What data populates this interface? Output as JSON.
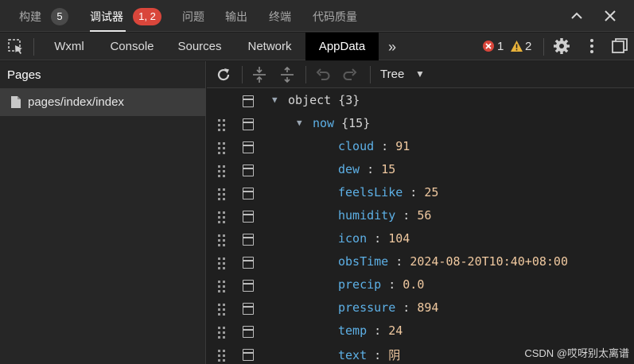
{
  "top_tabs": [
    {
      "label": "构建",
      "badge": "5"
    },
    {
      "label": "调试器",
      "badge": "1, 2"
    },
    {
      "label": "问题"
    },
    {
      "label": "输出"
    },
    {
      "label": "终端"
    },
    {
      "label": "代码质量"
    }
  ],
  "devtools": {
    "tabs": [
      "Wxml",
      "Console",
      "Sources",
      "Network",
      "AppData"
    ],
    "active_tab": "AppData",
    "error_count": "1",
    "warning_count": "2",
    "more_glyph": "»"
  },
  "pages_panel": {
    "title": "Pages",
    "items": [
      "pages/index/index"
    ]
  },
  "appdata_toolbar": {
    "mode_label": "Tree"
  },
  "tree": {
    "root": {
      "key": "object",
      "count": "{3}"
    },
    "now": {
      "key": "now",
      "count": "{15}"
    },
    "fields": [
      {
        "key": "cloud",
        "value": "91"
      },
      {
        "key": "dew",
        "value": "15"
      },
      {
        "key": "feelsLike",
        "value": "25"
      },
      {
        "key": "humidity",
        "value": "56"
      },
      {
        "key": "icon",
        "value": "104"
      },
      {
        "key": "obsTime",
        "value": "2024-08-20T10:40+08:00"
      },
      {
        "key": "precip",
        "value": "0.0"
      },
      {
        "key": "pressure",
        "value": "894"
      },
      {
        "key": "temp",
        "value": "24"
      },
      {
        "key": "text",
        "value": "阴"
      }
    ]
  },
  "watermark": "CSDN @哎呀别太离谱",
  "colors": {
    "key": "#5db0e6",
    "value": "#f0c9a0",
    "error": "#d9463b",
    "warning": "#e8b23a"
  }
}
